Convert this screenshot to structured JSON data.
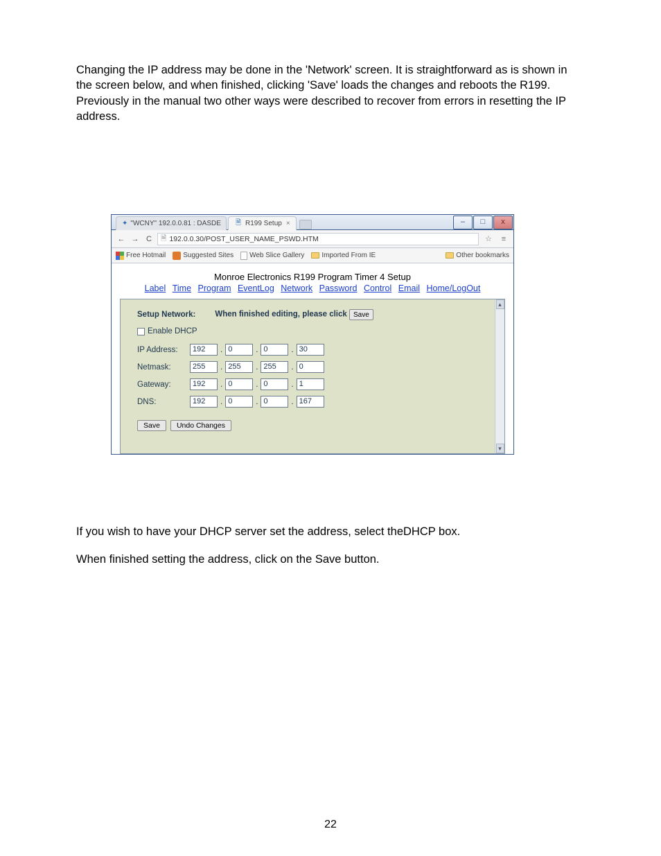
{
  "paragraphs": {
    "intro": "Changing the IP address may be done in the 'Network' screen. It is straightforward as is shown in the screen below, and when finished, clicking 'Save' loads the changes and reboots the R199.  Previously in the manual two other ways were described to recover from errors in resetting the IP address.",
    "dhcp_note": "If you wish to have your DHCP server set the address, select theDHCP box.",
    "save_note": "When finished setting the address, click on the Save button.",
    "page_number": "22"
  },
  "browser": {
    "win_controls": {
      "min": "–",
      "max": "□",
      "close": "x"
    },
    "tabs": {
      "inactive": "\"WCNY\" 192.0.0.81 : DASDE",
      "active": "R199 Setup"
    },
    "nav": {
      "back": "←",
      "forward": "→",
      "reload": "C",
      "star": "☆",
      "menu": "≡"
    },
    "address": "192.0.0.30/POST_USER_NAME_PSWD.HTM",
    "bookmarks": {
      "free_hotmail": "Free Hotmail",
      "suggested": "Suggested Sites",
      "web_slice": "Web Slice Gallery",
      "imported": "Imported From IE",
      "other": "Other bookmarks"
    }
  },
  "page": {
    "heading": "Monroe Electronics R199 Program Timer 4 Setup",
    "nav": [
      "Label",
      "Time",
      "Program",
      "EventLog",
      "Network",
      "Password",
      "Control",
      "Email",
      "Home/LogOut"
    ],
    "setup_label": "Setup Network:",
    "setup_hint": "When finished editing, please click",
    "inline_save": "Save",
    "enable_dhcp": "Enable DHCP",
    "rows": {
      "ip": {
        "label": "IP Address:",
        "o": [
          "192",
          "0",
          "0",
          "30"
        ]
      },
      "netmask": {
        "label": "Netmask:",
        "o": [
          "255",
          "255",
          "255",
          "0"
        ]
      },
      "gateway": {
        "label": "Gateway:",
        "o": [
          "192",
          "0",
          "0",
          "1"
        ]
      },
      "dns": {
        "label": "DNS:",
        "o": [
          "192",
          "0",
          "0",
          "167"
        ]
      }
    },
    "save_btn": "Save",
    "undo_btn": "Undo Changes"
  }
}
